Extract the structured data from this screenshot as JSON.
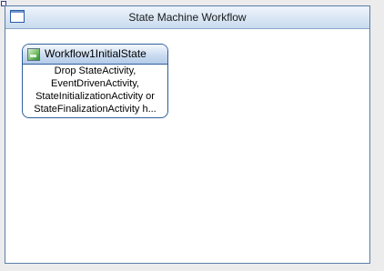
{
  "workflow": {
    "title": "State Machine Workflow",
    "icon": "workflow-icon"
  },
  "state": {
    "title": "Workflow1InitialState",
    "icon": "state-activity-icon",
    "body_lines": [
      "Drop StateActivity,",
      "EventDrivenActivity,",
      "StateInitializationActivity or",
      "StateFinalizationActivity h..."
    ]
  },
  "colors": {
    "frame_border": "#5a7da8",
    "state_border": "#2f5f9e",
    "header_gradient_top": "#eef4fb",
    "header_gradient_bottom": "#c9dbef"
  }
}
